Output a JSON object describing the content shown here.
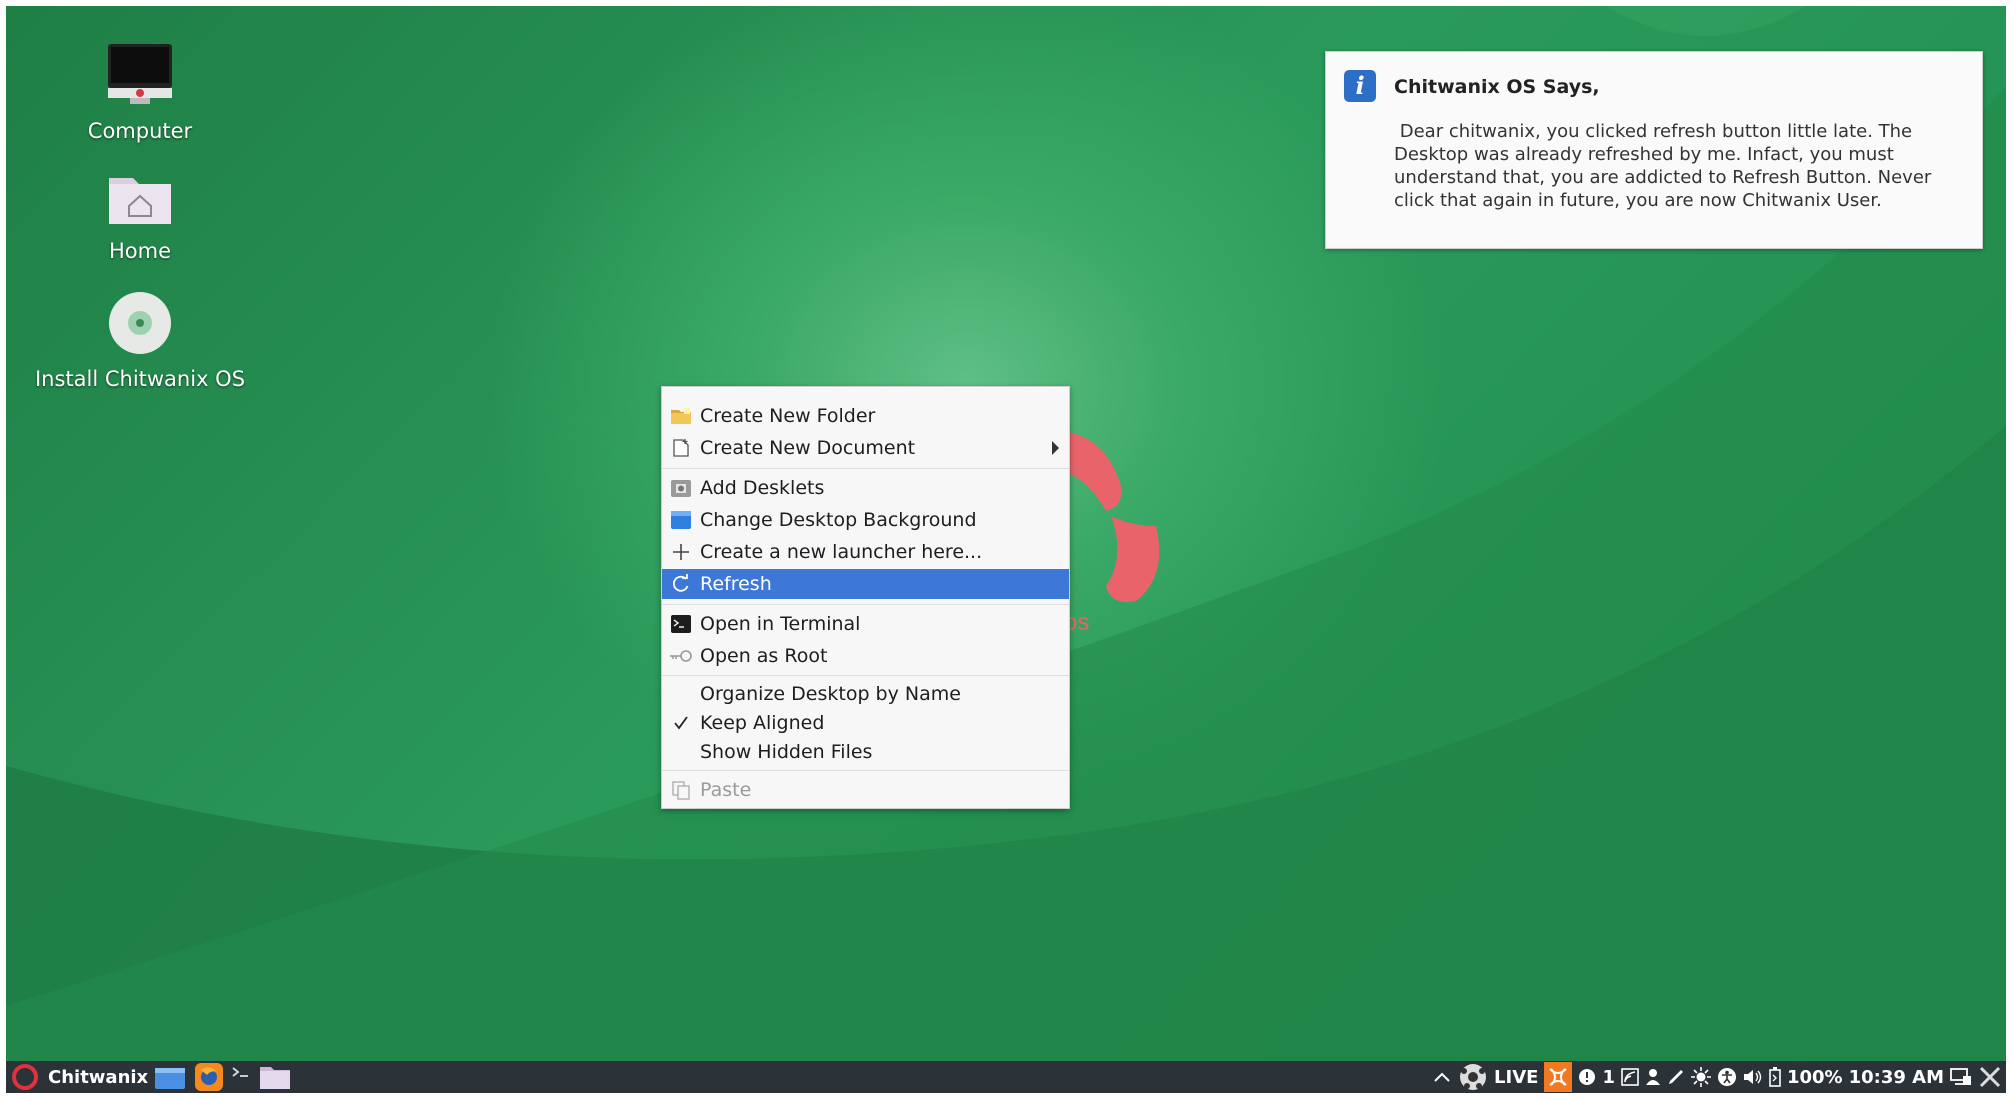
{
  "desktop": {
    "icons": [
      {
        "label": "Computer"
      },
      {
        "label": "Home"
      },
      {
        "label": "Install Chitwanix OS"
      }
    ]
  },
  "notification": {
    "title": "Chitwanix OS Says,",
    "body": " Dear chitwanix, you clicked refresh button little late. The Desktop was already refreshed by me. Infact, you must understand that, you are addicted to Refresh Button. Never click that again in future, you are now Chitwanix User.",
    "icon": "info-icon"
  },
  "context_menu": {
    "items": [
      {
        "label": "Create New Folder",
        "icon": "folder-icon"
      },
      {
        "label": "Create New Document",
        "icon": "document-icon",
        "submenu": true
      },
      {
        "label": "Add Desklets",
        "icon": "desklet-icon"
      },
      {
        "label": "Change Desktop Background",
        "icon": "background-icon"
      },
      {
        "label": "Create a new launcher here...",
        "icon": "plus-icon"
      },
      {
        "label": "Refresh",
        "icon": "refresh-icon",
        "selected": true
      },
      {
        "label": "Open in Terminal",
        "icon": "terminal-icon"
      },
      {
        "label": "Open as Root",
        "icon": "key-icon"
      },
      {
        "label": "Organize Desktop by Name"
      },
      {
        "label": "Keep Aligned",
        "checked": true
      },
      {
        "label": "Show Hidden Files"
      },
      {
        "label": "Paste",
        "icon": "paste-icon",
        "disabled": true
      }
    ]
  },
  "logo_partial_text": "os",
  "taskbar": {
    "menu_label": "Chitwanix",
    "tray": {
      "live": "LIVE",
      "workspace": "1",
      "battery": "100%",
      "time": "10:39 AM"
    }
  },
  "colors": {
    "accent": "#3d78d8",
    "desktop_green": "#2a9a5a",
    "logo_red": "#e8646a",
    "taskbar": "#2b3238"
  }
}
